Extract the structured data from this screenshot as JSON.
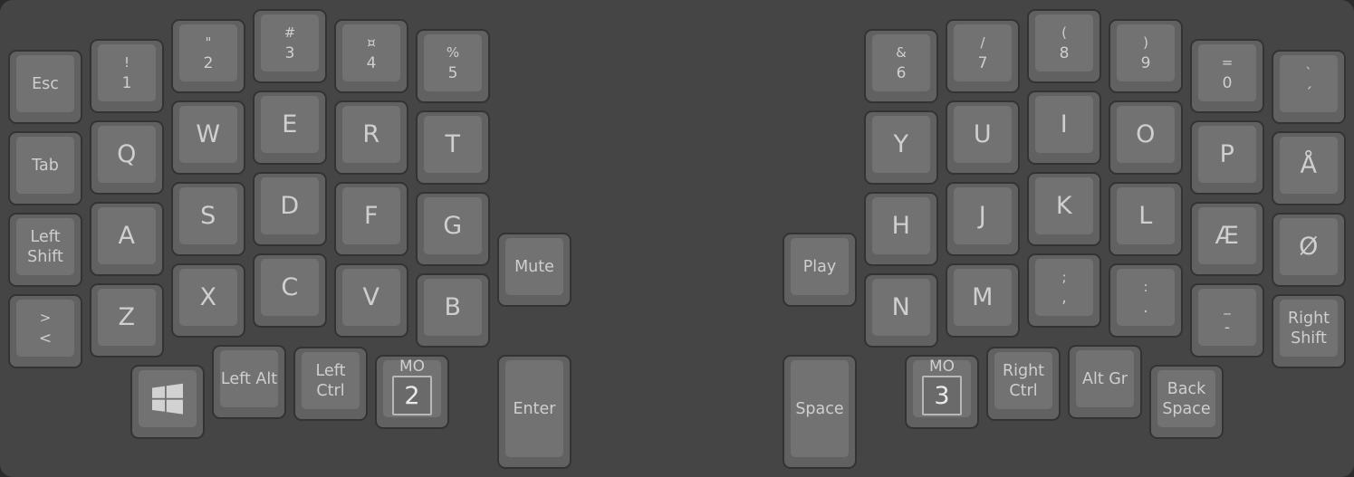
{
  "keyboard": {
    "left": {
      "number_row": [
        {
          "name": "esc",
          "label": "Esc"
        },
        {
          "name": "1",
          "shift": "!",
          "base": "1"
        },
        {
          "name": "2",
          "shift": "\"",
          "base": "2"
        },
        {
          "name": "3",
          "shift": "#",
          "base": "3"
        },
        {
          "name": "4",
          "shift": "¤",
          "base": "4"
        },
        {
          "name": "5",
          "shift": "%",
          "base": "5"
        }
      ],
      "top_row": [
        {
          "name": "tab",
          "label": "Tab"
        },
        {
          "name": "q",
          "letter": "Q"
        },
        {
          "name": "w",
          "letter": "W"
        },
        {
          "name": "e",
          "letter": "E"
        },
        {
          "name": "r",
          "letter": "R"
        },
        {
          "name": "t",
          "letter": "T"
        }
      ],
      "home_row": [
        {
          "name": "left-shift",
          "label": "Left Shift"
        },
        {
          "name": "a",
          "letter": "A"
        },
        {
          "name": "s",
          "letter": "S"
        },
        {
          "name": "d",
          "letter": "D"
        },
        {
          "name": "f",
          "letter": "F"
        },
        {
          "name": "g",
          "letter": "G"
        }
      ],
      "bottom_row": [
        {
          "name": "angle-brackets",
          "shift": ">",
          "base": "<"
        },
        {
          "name": "z",
          "letter": "Z"
        },
        {
          "name": "x",
          "letter": "X"
        },
        {
          "name": "c",
          "letter": "C"
        },
        {
          "name": "v",
          "letter": "V"
        },
        {
          "name": "b",
          "letter": "B"
        }
      ],
      "extra": {
        "name": "mute",
        "label": "Mute"
      },
      "thumb": [
        {
          "name": "windows",
          "icon": "windows-icon"
        },
        {
          "name": "left-alt",
          "label": "Left Alt"
        },
        {
          "name": "left-ctrl",
          "label": "Left Ctrl"
        },
        {
          "name": "mo-2",
          "mo_label": "MO",
          "layer": "2"
        },
        {
          "name": "enter",
          "label": "Enter"
        }
      ]
    },
    "right": {
      "number_row": [
        {
          "name": "6",
          "shift": "&",
          "base": "6"
        },
        {
          "name": "7",
          "shift": "/",
          "base": "7"
        },
        {
          "name": "8",
          "shift": "(",
          "base": "8"
        },
        {
          "name": "9",
          "shift": ")",
          "base": "9"
        },
        {
          "name": "0",
          "shift": "=",
          "base": "0"
        },
        {
          "name": "grave-acute",
          "shift": "`",
          "base": "´"
        }
      ],
      "top_row": [
        {
          "name": "y",
          "letter": "Y"
        },
        {
          "name": "u",
          "letter": "U"
        },
        {
          "name": "i",
          "letter": "I"
        },
        {
          "name": "o",
          "letter": "O"
        },
        {
          "name": "p",
          "letter": "P"
        },
        {
          "name": "a-ring",
          "letter": "Å"
        }
      ],
      "home_row": [
        {
          "name": "h",
          "letter": "H"
        },
        {
          "name": "j",
          "letter": "J"
        },
        {
          "name": "k",
          "letter": "K"
        },
        {
          "name": "l",
          "letter": "L"
        },
        {
          "name": "ae",
          "letter": "Æ"
        },
        {
          "name": "o-slash",
          "letter": "Ø"
        }
      ],
      "bottom_row": [
        {
          "name": "n",
          "letter": "N"
        },
        {
          "name": "m",
          "letter": "M"
        },
        {
          "name": "semicolon-comma",
          "shift": ";",
          "base": ","
        },
        {
          "name": "colon-period",
          "shift": ":",
          "base": "."
        },
        {
          "name": "underscore-minus",
          "shift": "_",
          "base": "-"
        },
        {
          "name": "right-shift",
          "label": "Right Shift"
        }
      ],
      "extra": {
        "name": "play",
        "label": "Play"
      },
      "thumb": [
        {
          "name": "space",
          "label": "Space"
        },
        {
          "name": "mo-3",
          "mo_label": "MO",
          "layer": "3"
        },
        {
          "name": "right-ctrl",
          "label": "Right Ctrl"
        },
        {
          "name": "alt-gr",
          "label": "Alt Gr"
        },
        {
          "name": "backspace",
          "label": "Back Space"
        }
      ]
    }
  },
  "colors": {
    "background": "#454545",
    "key_border": "#333333",
    "key_side": "#616161",
    "key_top": "#727272",
    "legend": "#cfcfcf"
  }
}
